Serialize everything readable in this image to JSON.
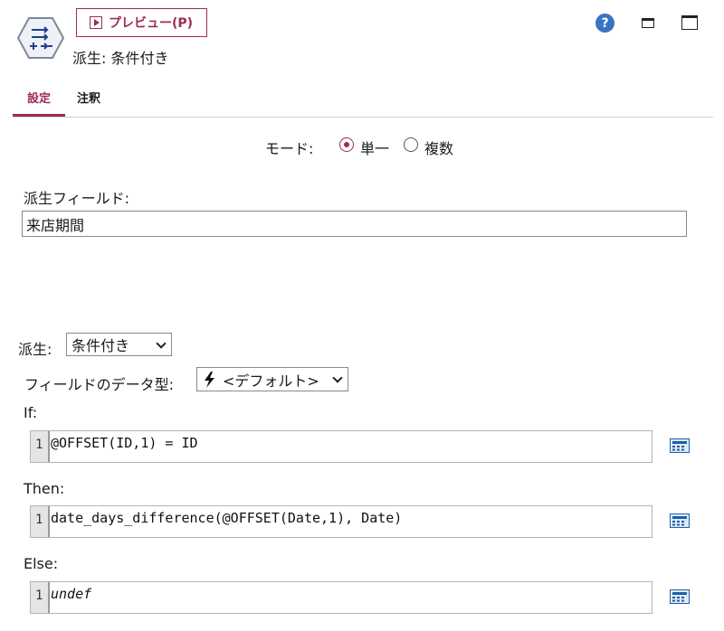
{
  "header": {
    "preview_label": "プレビュー(P)",
    "node_title": "派生: 条件付き",
    "icons": [
      "derive-node-icon",
      "play-icon",
      "help-icon",
      "minimize-icon",
      "maximize-icon"
    ],
    "help_glyph": "?"
  },
  "tabs": [
    {
      "label": "設定",
      "active": true
    },
    {
      "label": "注釈",
      "active": false
    }
  ],
  "mode": {
    "label": "モード:",
    "options": [
      {
        "label": "単一",
        "selected": true
      },
      {
        "label": "複数",
        "selected": false
      }
    ]
  },
  "derive_field": {
    "label": "派生フィールド:",
    "value": "来店期間"
  },
  "derive_as": {
    "label": "派生:",
    "selected": "条件付き"
  },
  "field_type": {
    "label": "フィールドのデータ型:",
    "selected": "<デフォルト>",
    "icon": "lightning-icon"
  },
  "expressions": [
    {
      "label": "If:",
      "line_number": "1",
      "code": "@OFFSET(ID,1) = ID"
    },
    {
      "label": "Then:",
      "line_number": "1",
      "code": "date_days_difference(@OFFSET(Date,1), Date)"
    },
    {
      "label": "Else:",
      "line_number": "1",
      "code": "undef"
    }
  ],
  "colors": {
    "accent": "#9e2b5a",
    "help_blue": "#3a73c4",
    "calculator_blue": "#1f5fa8"
  }
}
